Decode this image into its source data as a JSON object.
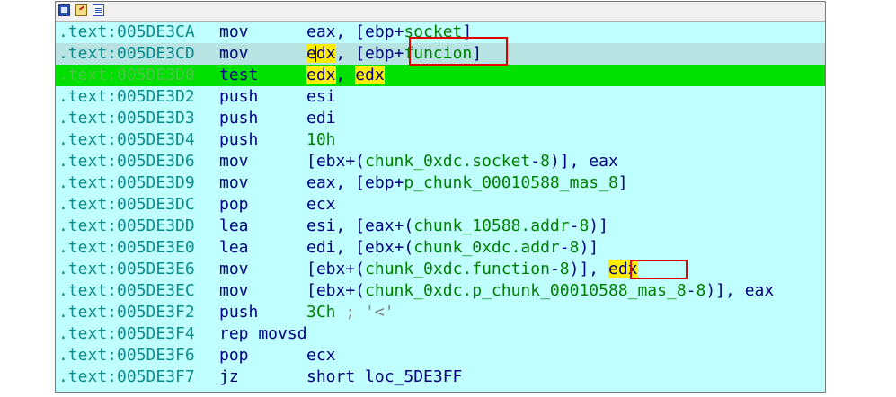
{
  "toolbar": {
    "icons": [
      "graph-view-icon",
      "edit-icon",
      "text-view-icon"
    ]
  },
  "lines": [
    {
      "addr": ".text:005DE3CA",
      "mnemonic": "mov",
      "ops": [
        [
          "plain",
          "eax, [ebp+"
        ],
        [
          "sym",
          "socket"
        ],
        [
          "plain",
          "]"
        ]
      ]
    },
    {
      "addr": ".text:005DE3CD",
      "mnemonic": "mov",
      "ops": [
        [
          "hl",
          "e"
        ],
        [
          "cursor",
          ""
        ],
        [
          "hl",
          "dx"
        ],
        [
          "plain",
          ", [ebp+"
        ],
        [
          "sym",
          "funcion"
        ],
        [
          "plain",
          "]"
        ]
      ],
      "state": "sel"
    },
    {
      "addr": ".text:005DE3D0",
      "mnemonic": "test",
      "ops": [
        [
          "hl",
          "edx"
        ],
        [
          "plain",
          ", "
        ],
        [
          "hl",
          "edx"
        ]
      ],
      "state": "hl"
    },
    {
      "addr": ".text:005DE3D2",
      "mnemonic": "push",
      "ops": [
        [
          "plain",
          "esi"
        ]
      ]
    },
    {
      "addr": ".text:005DE3D3",
      "mnemonic": "push",
      "ops": [
        [
          "plain",
          "edi"
        ]
      ]
    },
    {
      "addr": ".text:005DE3D4",
      "mnemonic": "push",
      "ops": [
        [
          "num",
          "10h"
        ]
      ]
    },
    {
      "addr": ".text:005DE3D6",
      "mnemonic": "mov",
      "ops": [
        [
          "plain",
          "[ebx+("
        ],
        [
          "sym",
          "chunk_0xdc.socket"
        ],
        [
          "plain",
          "-"
        ],
        [
          "num",
          "8"
        ],
        [
          "plain",
          ")], eax"
        ]
      ]
    },
    {
      "addr": ".text:005DE3D9",
      "mnemonic": "mov",
      "ops": [
        [
          "plain",
          "eax, [ebp+"
        ],
        [
          "sym",
          "p_chunk_00010588_mas_8"
        ],
        [
          "plain",
          "]"
        ]
      ]
    },
    {
      "addr": ".text:005DE3DC",
      "mnemonic": "pop",
      "ops": [
        [
          "plain",
          "ecx"
        ]
      ]
    },
    {
      "addr": ".text:005DE3DD",
      "mnemonic": "lea",
      "ops": [
        [
          "plain",
          "esi, [eax+("
        ],
        [
          "sym",
          "chunk_10588.addr"
        ],
        [
          "plain",
          "-"
        ],
        [
          "num",
          "8"
        ],
        [
          "plain",
          ")]"
        ]
      ]
    },
    {
      "addr": ".text:005DE3E0",
      "mnemonic": "lea",
      "ops": [
        [
          "plain",
          "edi, [ebx+("
        ],
        [
          "sym",
          "chunk_0xdc.addr"
        ],
        [
          "plain",
          "-"
        ],
        [
          "num",
          "8"
        ],
        [
          "plain",
          ")]"
        ]
      ]
    },
    {
      "addr": ".text:005DE3E6",
      "mnemonic": "mov",
      "ops": [
        [
          "plain",
          "[ebx+("
        ],
        [
          "sym",
          "chunk_0xdc.function"
        ],
        [
          "plain",
          "-"
        ],
        [
          "num",
          "8"
        ],
        [
          "plain",
          ")], "
        ],
        [
          "hl",
          "edx"
        ]
      ]
    },
    {
      "addr": ".text:005DE3EC",
      "mnemonic": "mov",
      "ops": [
        [
          "plain",
          "[ebx+("
        ],
        [
          "sym",
          "chunk_0xdc.p_chunk_00010588_mas_8"
        ],
        [
          "plain",
          "-"
        ],
        [
          "num",
          "8"
        ],
        [
          "plain",
          ")], eax"
        ]
      ]
    },
    {
      "addr": ".text:005DE3F2",
      "mnemonic": "push",
      "ops": [
        [
          "num",
          "3Ch"
        ],
        [
          "plain",
          " "
        ],
        [
          "cmt",
          ";"
        ],
        [
          "plain",
          " "
        ],
        [
          "str",
          "'<'"
        ]
      ]
    },
    {
      "addr": ".text:005DE3F4",
      "mnemonic": "rep movsd",
      "ops": []
    },
    {
      "addr": ".text:005DE3F6",
      "mnemonic": "pop",
      "ops": [
        [
          "plain",
          "ecx"
        ]
      ]
    },
    {
      "addr": ".text:005DE3F7",
      "mnemonic": "jz",
      "ops": [
        [
          "plain",
          "short loc_5DE3FF"
        ]
      ]
    }
  ],
  "annotations": [
    {
      "name": "funcion-operand-box",
      "color": "#e00000"
    },
    {
      "name": "edx-operand-box",
      "color": "#e00000"
    }
  ]
}
